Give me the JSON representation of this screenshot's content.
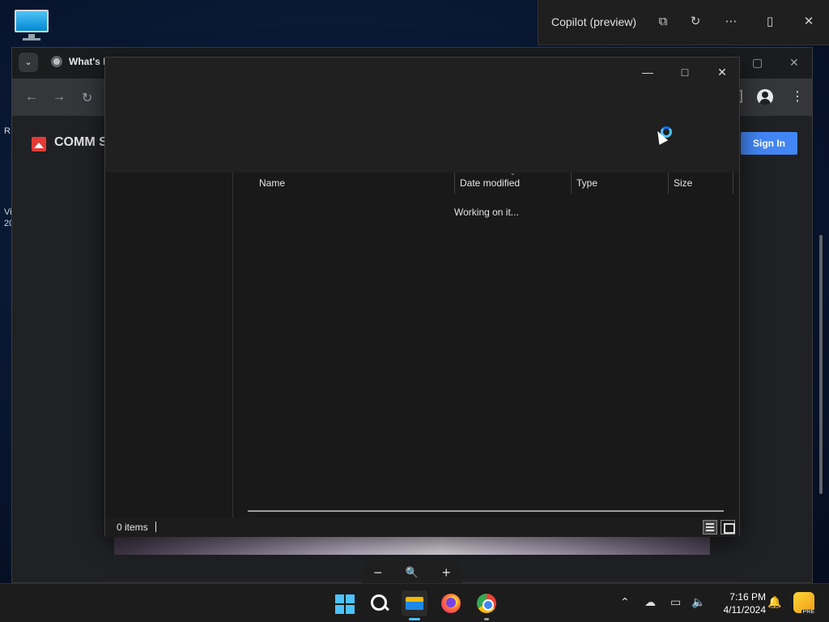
{
  "desktop": {
    "fragments": [
      "R",
      "Vi",
      "20"
    ]
  },
  "browser": {
    "tab_title": "What's I",
    "site_name": "COMM S",
    "sign_in_label": "Sign In",
    "nav": {
      "back": "←",
      "forward": "→",
      "reload": "↻"
    },
    "menu_glyph": "⋮",
    "tab_dropdown_glyph": "⌄",
    "zoom": {
      "out": "−",
      "reset": "🔍",
      "in": "+"
    },
    "win_restore_glyph": "▢",
    "win_close_glyph": "✕"
  },
  "copilot": {
    "title": "Copilot (preview)",
    "buttons": {
      "open": "⧉",
      "refresh": "↻",
      "more": "⋯",
      "sidebar": "▯",
      "close": "✕"
    }
  },
  "file_dialog": {
    "window_buttons": {
      "minimize": "—",
      "maximize": "□",
      "close": "✕"
    },
    "columns": [
      "Name",
      "Date modified",
      "Type",
      "Size"
    ],
    "sort_indicator": "⌄",
    "loading_text": "Working on it...",
    "status": {
      "items": "0 items"
    }
  },
  "taskbar": {
    "clock": {
      "time": "7:16 PM",
      "date": "4/11/2024"
    },
    "tray": {
      "chevron": "⌃",
      "cloud": "☁",
      "display": "▭",
      "volume": "🔈",
      "notifications": "🔔"
    },
    "copilot_badge": "PRE"
  },
  "colors": {
    "accent": "#4cc2ff",
    "sign_in": "#4285f4",
    "dialog_bg": "#191919"
  }
}
